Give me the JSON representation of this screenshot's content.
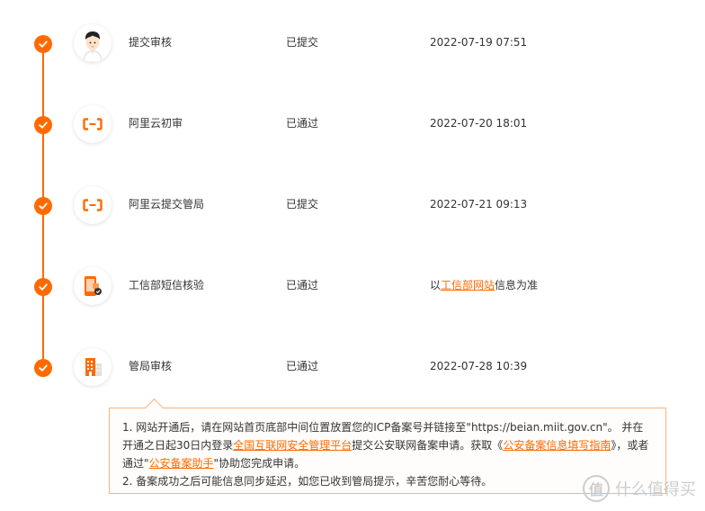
{
  "colors": {
    "accent": "#ff6a00",
    "notice_border": "#ffb27a",
    "text": "#333333"
  },
  "steps": [
    {
      "icon": "person-avatar-icon",
      "name": "提交审核",
      "status": "已提交",
      "time": "2022-07-19 07:51"
    },
    {
      "icon": "aliyun-logo-icon",
      "name": "阿里云初审",
      "status": "已通过",
      "time": "2022-07-20 18:01"
    },
    {
      "icon": "aliyun-logo-icon",
      "name": "阿里云提交管局",
      "status": "已提交",
      "time": "2022-07-21 09:13"
    },
    {
      "icon": "phone-sms-icon",
      "name": "工信部短信核验",
      "status": "已通过",
      "time_prefix": "以",
      "time_link": "工信部网站",
      "time_suffix": "信息为准"
    },
    {
      "icon": "building-icon",
      "name": "管局审核",
      "status": "已通过",
      "time": "2022-07-28 10:39"
    }
  ],
  "notice": {
    "p1_a": "1. 网站开通后，请在网站首页底部中间位置放置您的ICP备案号并链接至\"https://beian.miit.gov.cn\"。 并在开通之日起30日内登录",
    "p1_link1": "全国互联网安全管理平台",
    "p1_b": "提交公安联网备案申请。获取《",
    "p1_link2": "公安备案信息填写指南",
    "p1_c": "》，或者通过\"",
    "p1_link3": "公安备案助手",
    "p1_d": "\"协助您完成申请。",
    "p2": "2. 备案成功之后可能信息同步延迟，如您已收到管局提示，辛苦您耐心等待。"
  },
  "watermark": {
    "logo_char": "值",
    "text": "什么值得买"
  }
}
